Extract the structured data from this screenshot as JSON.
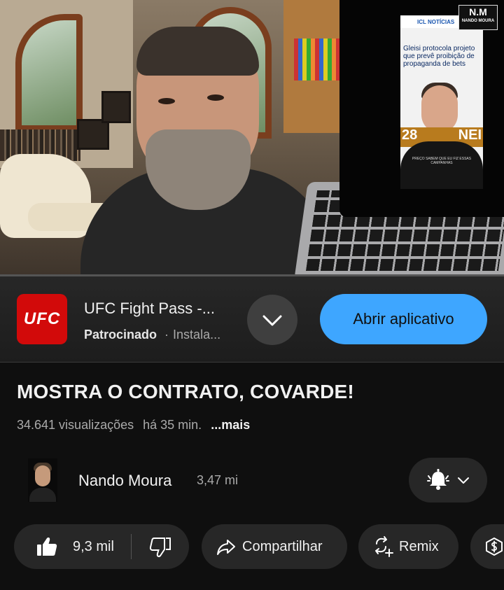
{
  "overlay": {
    "logo_big": "N.M",
    "logo_small": "NANDO MOURA"
  },
  "video_screen": {
    "site_header": "ICL NOTÍCIAS",
    "headline": "Gleisi protocola projeto que prevê proibição de propaganda de bets",
    "num_left": "28",
    "num_right": "NEI",
    "caption": "PREÇO SABEM QUE EU FIZ ESSAS CAMPANHAS"
  },
  "ad": {
    "logo_text": "UFC",
    "title": "UFC Fight Pass -...",
    "sponsored": "Patrocinado",
    "separator": "·",
    "install": "Instala...",
    "open_button": "Abrir aplicativo",
    "colors": {
      "logo_bg": "#d20a0a",
      "button_bg": "#3ea6ff"
    }
  },
  "video": {
    "title": "MOSTRA O CONTRATO, COVARDE!",
    "views": "34.641 visualizações",
    "time": "há 35 min.",
    "more": "...mais"
  },
  "channel": {
    "name": "Nando Moura",
    "subscribers": "3,47 mi"
  },
  "actions": {
    "likes": "9,3 mil",
    "share": "Compartilhar",
    "remix": "Remix"
  },
  "icons": [
    "bell-icon",
    "chevron-down-icon",
    "thumbs-up-icon",
    "thumbs-down-icon",
    "share-icon",
    "remix-icon",
    "thanks-icon"
  ]
}
